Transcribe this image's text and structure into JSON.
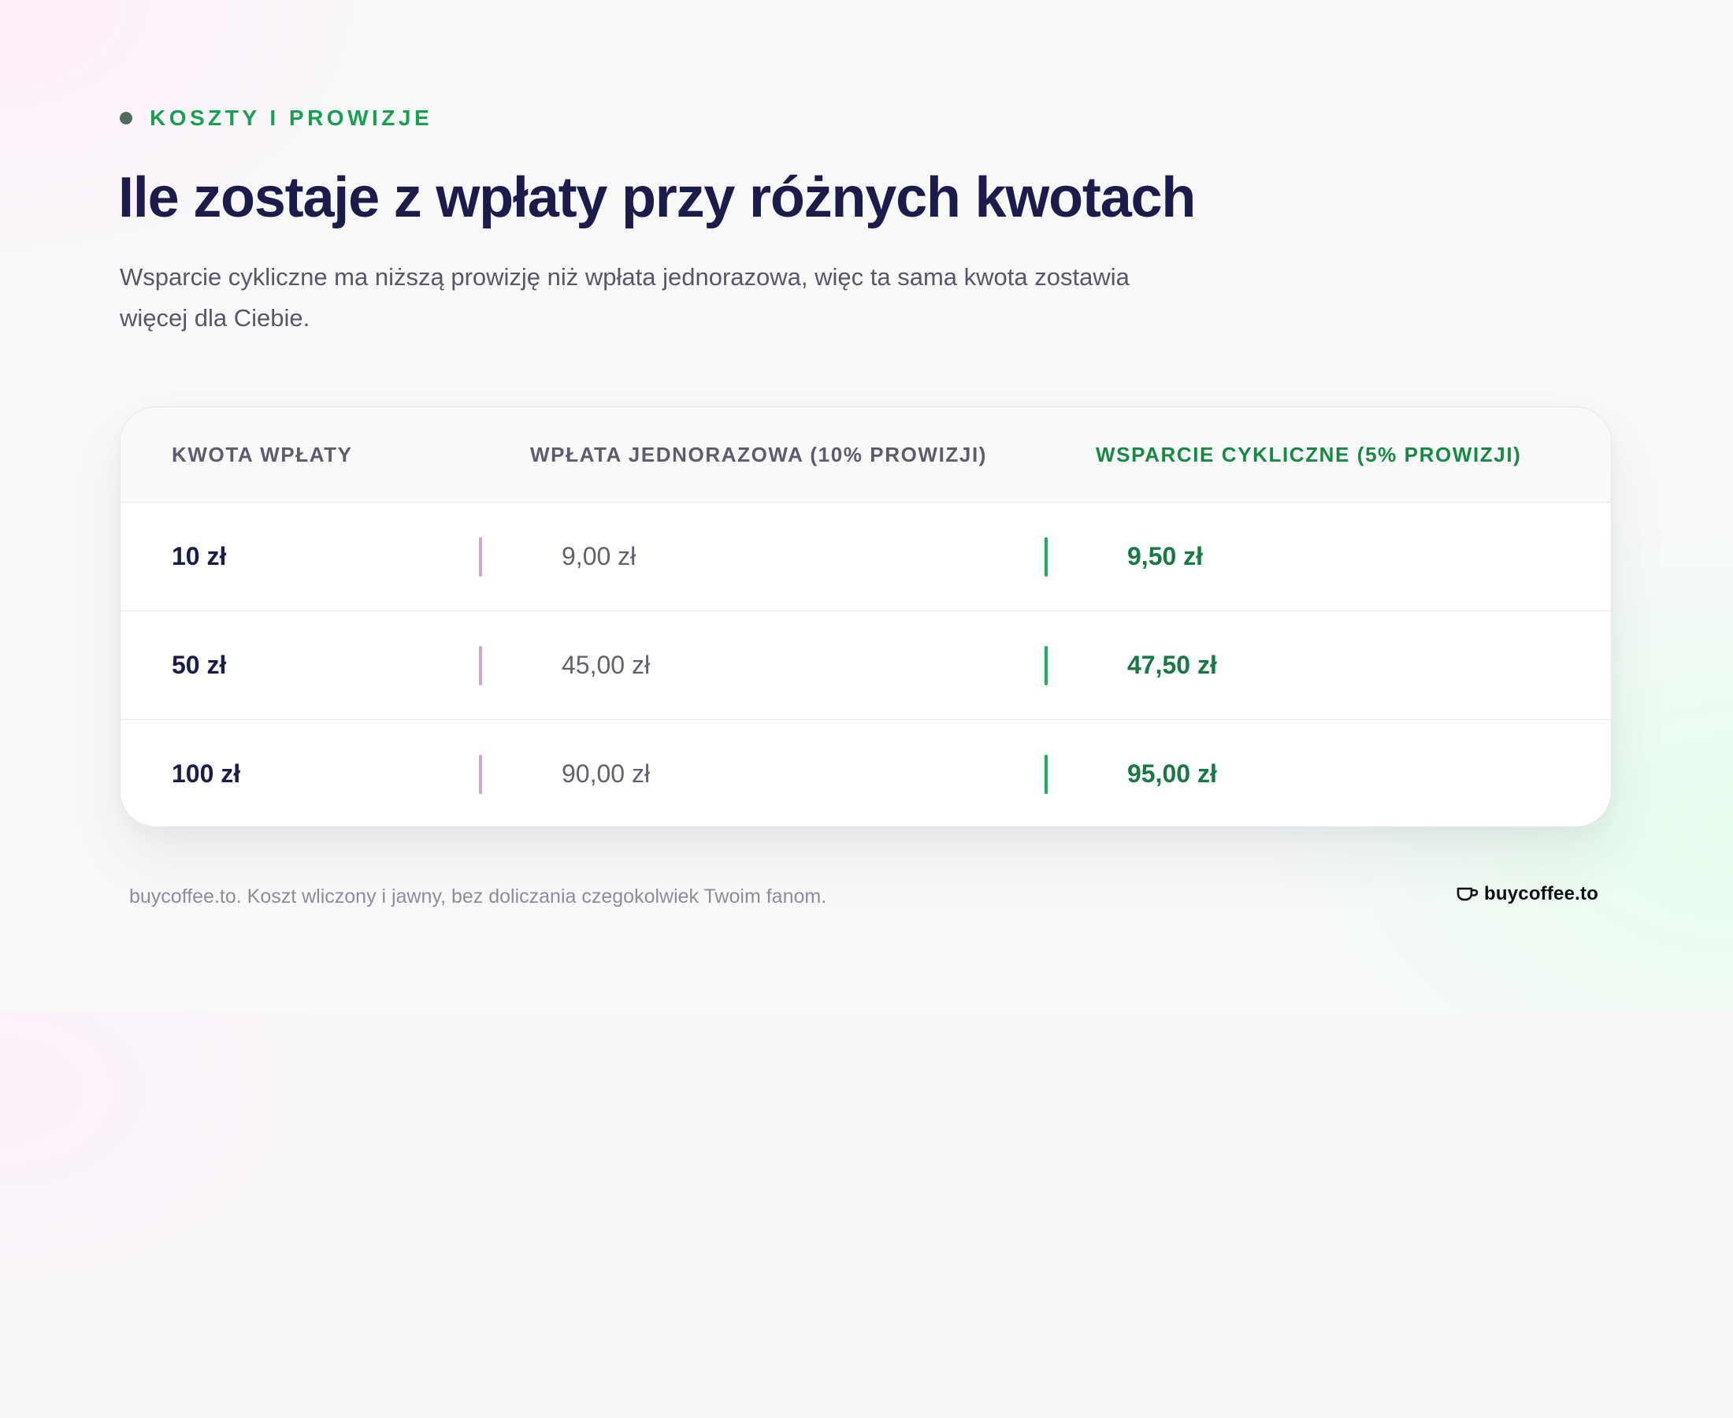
{
  "header": {
    "eyebrow": "KOSZTY I PROWIZJE",
    "title": "Ile zostaje z wpłaty przy różnych kwotach",
    "subtitle": "Wsparcie cykliczne ma niższą prowizję niż wpłata jednorazowa, więc ta sama kwota zostawia więcej dla Ciebie."
  },
  "table": {
    "columns": [
      "KWOTA WPŁATY",
      "WPŁATA JEDNORAZOWA (10% PROWIZJI)",
      "WSPARCIE CYKLICZNE (5% PROWIZJI)"
    ],
    "rows": [
      {
        "amount": "10 zł",
        "single": "9,00 zł",
        "recurring": "9,50 zł"
      },
      {
        "amount": "50 zł",
        "single": "45,00 zł",
        "recurring": "47,50 zł"
      },
      {
        "amount": "100 zł",
        "single": "90,00 zł",
        "recurring": "95,00 zł"
      }
    ]
  },
  "footer": {
    "note": "buycoffee.to. Koszt wliczony i jawny, bez doliczania czegokolwiek Twoim fanom.",
    "brand": "buycoffee.to",
    "brand_icon": "coffee-cup-icon"
  },
  "colors": {
    "accent_green": "#16a150",
    "title_navy": "#1c1b4b",
    "single_bar": "#d1a6c7",
    "recurring_bar": "#1eab5a"
  }
}
